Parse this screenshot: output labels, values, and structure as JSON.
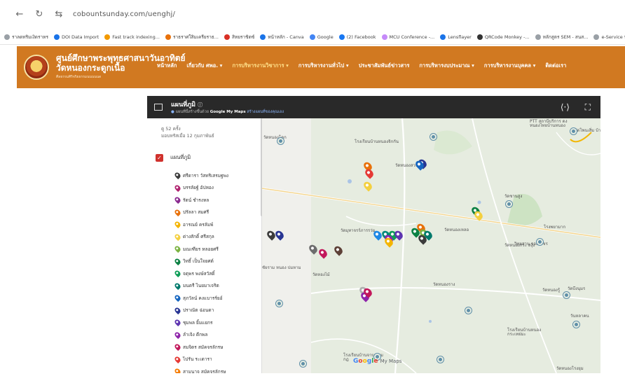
{
  "browser": {
    "url": "cobountsunday.com/uenghj/",
    "bookmarks": [
      {
        "label": "ราลดทริมเงิดราหร",
        "color": "#9aa0a6"
      },
      {
        "label": "DOI Data Import",
        "color": "#1a73e8"
      },
      {
        "label": "Fast track indexing...",
        "color": "#f29900"
      },
      {
        "label": "ราธราศใสิมเครียราธ...",
        "color": "#e8710a"
      },
      {
        "label": "สิทยราชิตซ์",
        "color": "#d93025"
      },
      {
        "label": "หน้าหลัก - Canva",
        "color": "#1a73e8"
      },
      {
        "label": "Google",
        "color": "#4285f4"
      },
      {
        "label": "(2) Facebook",
        "color": "#1877f2"
      },
      {
        "label": "MCU Conference -...",
        "color": "#c58af9"
      },
      {
        "label": "Lensflayer",
        "color": "#1a73e8"
      },
      {
        "label": "QRCode Monkey -...",
        "color": "#333333"
      },
      {
        "label": "หลักสูตร SEM - สนส...",
        "color": "#9aa0a6"
      },
      {
        "label": "e-Service ทะเบย",
        "color": "#9aa0a6"
      }
    ]
  },
  "site": {
    "title_line1": "ศูนย์ศึกษาพระพุทธศาสนาวันอาทิตย์",
    "title_line2": "วัดหนองกระดูกเนื้อ",
    "subtitle": "ศีลธรรมศิริจริยธรรมนนนนนด",
    "nav": [
      {
        "label": "หน้าหลัก",
        "active": false
      },
      {
        "label": "เกี่ยวกับ ศพอ. ▾",
        "active": false
      },
      {
        "label": "การบริหารงานวิชาการ ▾",
        "active": true
      },
      {
        "label": "การบริหารงานทั่วไป ▾",
        "active": false
      },
      {
        "label": "ประชาสัมพันธ์ข่าวสาร",
        "active": false
      },
      {
        "label": "การบริหารงบประมาณ ▾",
        "active": false
      },
      {
        "label": "การบริหารงานบุคคล ▾",
        "active": false
      },
      {
        "label": "ติดต่อเรา",
        "active": false
      }
    ],
    "colors": {
      "header": "#d17921",
      "active_nav": "#ffe08a"
    }
  },
  "map": {
    "name": "แผนที่ภูมิ",
    "credit_prefix": "แผนที่นี้สร้างขึ้นด้วย",
    "credit_brand": "Google My Maps",
    "credit_link": "สร้างแผนที่ของคุณเอง",
    "views_line1": "ดู 52 ครั้ง",
    "views_line2": "มอบหรัสเมื่อ 12 กุมภาพันธ์",
    "layer_title": "แผนที่ภูมิ",
    "people": [
      {
        "name": "ศรีดารา วัสทริเสรมฐพง",
        "color": "#3c3c3c"
      },
      {
        "name": "บรรลัยฐ์ อัปหอง",
        "color": "#b0226e"
      },
      {
        "name": "รัตน์ ชำรงหล",
        "color": "#8a2a8f"
      },
      {
        "name": "ปรัลลา สมศรี",
        "color": "#e8710a"
      },
      {
        "name": "อารณย์ ครลัมพ์",
        "color": "#f4b400"
      },
      {
        "name": "ด่างสักดิ์ ศรีสกุล",
        "color": "#f4d03f"
      },
      {
        "name": "มณเฑียร หลอยศรี",
        "color": "#7cb342"
      },
      {
        "name": "วิทธิ์ เป็นใจยศต์",
        "color": "#0b8043"
      },
      {
        "name": "จตุพร พงษ์สวัสดิ์",
        "color": "#0f9d58"
      },
      {
        "name": "มนตรี ไนยมาเจริต",
        "color": "#00796b"
      },
      {
        "name": "สุภวัลน์ คงแบารร์ยอ์",
        "color": "#1565c0"
      },
      {
        "name": "ปราณัต ฉ่อนดา",
        "color": "#283593"
      },
      {
        "name": "ชุมพล ยิ้มแยกร",
        "color": "#5e35b1"
      },
      {
        "name": "ลำเจิง ดีกพล",
        "color": "#8e24aa"
      },
      {
        "name": "สมจิตร สมัคจรลักรษ",
        "color": "#c2185b"
      },
      {
        "name": "ไปรัน ระเดารา",
        "color": "#e53935"
      },
      {
        "name": "สามนาจ สมัคจรลักรษ",
        "color": "#f57c00"
      }
    ],
    "places": [
      {
        "label": "โรงเรียนบ้านหนองจิกกัน",
        "name": "place-school-north"
      },
      {
        "label": "วัดหนองสวน",
        "name": "place-wat-nongsuan"
      },
      {
        "label": "PTT สถานีบริการ ดงหนองไทยบ้านหนอง",
        "name": "place-ptt"
      },
      {
        "label": "วัดโพนเสิ่ม บ้านหนอง",
        "name": "place-wat-phonsoem"
      },
      {
        "label": "วัดชานสูง",
        "name": "place-wat-chansung"
      },
      {
        "label": "วัดหนองกระ สงุ้ง",
        "name": "place-wat-nongkra"
      },
      {
        "label": "วิทยสาน จองราชร",
        "name": "place-wat-nongrao"
      },
      {
        "label": "วัดหนองรู้",
        "name": "place-wat-nongru"
      },
      {
        "label": "ชัยราม หนอง ปมหาม",
        "name": "place-chaiyaram"
      },
      {
        "label": "วัดหองไม้",
        "name": "place-wat-nongmai"
      },
      {
        "label": "วัดหนองราง",
        "name": "place-wat-nongrang"
      },
      {
        "label": "วัดบึงนุมร",
        "name": "place-wat-buengnum"
      },
      {
        "label": "โรงเรียนบ้านหนอง กระเทย่มะ",
        "name": "place-school-east"
      },
      {
        "label": "โรงเรียนบ้านจาน ร่วมกฎ",
        "name": "place-school-middle"
      },
      {
        "label": "วัดหนองโคก",
        "name": "place-wat-nongkhok"
      },
      {
        "label": "โรงพยามาก",
        "name": "place-hospital"
      },
      {
        "label": "วัดหนองเหลอ",
        "name": "place-wat-nonglhao"
      },
      {
        "label": "วันหลาคน",
        "name": "place-wanlakhon"
      },
      {
        "label": "วัดหนองโรงยุม",
        "name": "place-wat-nongrongyum"
      },
      {
        "label": "วัดมุทาจรร์ภารรว่ม",
        "name": "place-wat-muthajan"
      }
    ],
    "google": {
      "g1": "G",
      "g2": "o",
      "g3": "o",
      "g4": "g",
      "g5": "l",
      "g6": "e",
      "suffix": "My Maps"
    },
    "share_icon": "share-icon",
    "fullscreen_icon": "fullscreen-icon"
  }
}
